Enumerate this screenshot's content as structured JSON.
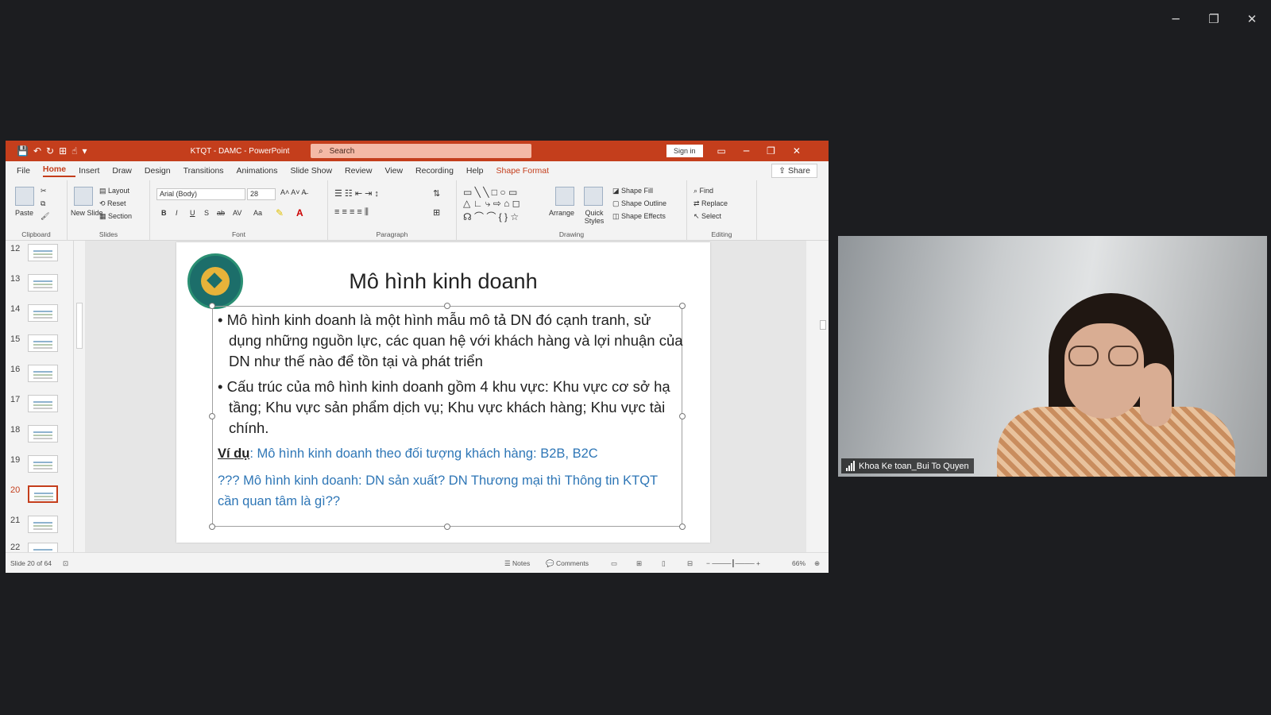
{
  "window_controls": {
    "minimize": "─",
    "restore": "❐",
    "close": "✕"
  },
  "ppt": {
    "qat_icons": [
      "save-icon",
      "undo-icon",
      "redo-icon",
      "present-icon",
      "touch-icon",
      "customize-icon"
    ],
    "qat_glyphs": [
      "💾",
      "↶",
      "↻",
      "⊞",
      "☝",
      "▾"
    ],
    "title": "KTQT - DAMC  -  PowerPoint",
    "search_placeholder": "Search",
    "sign_in": "Sign in",
    "title_controls": {
      "ribbon_display": "▭",
      "minimize": "─",
      "restore": "❐",
      "close": "✕"
    },
    "menu": [
      "File",
      "Home",
      "Insert",
      "Draw",
      "Design",
      "Transitions",
      "Animations",
      "Slide Show",
      "Review",
      "View",
      "Recording",
      "Help",
      "Shape Format"
    ],
    "active_menu": "Home",
    "share": "Share",
    "ribbon": {
      "clipboard": {
        "label": "Clipboard",
        "paste": "Paste"
      },
      "slides": {
        "label": "Slides",
        "new_slide": "New Slide",
        "layout": "Layout",
        "reset": "Reset",
        "section": "Section"
      },
      "font": {
        "label": "Font",
        "font_name": "Arial (Body)",
        "font_size": "28",
        "buttons": [
          "B",
          "I",
          "U",
          "S",
          "ab",
          "AV",
          "Aa"
        ]
      },
      "paragraph": {
        "label": "Paragraph"
      },
      "drawing": {
        "label": "Drawing",
        "arrange": "Arrange",
        "quick_styles": "Quick Styles",
        "shape_fill": "Shape Fill",
        "shape_outline": "Shape Outline",
        "shape_effects": "Shape Effects"
      },
      "editing": {
        "label": "Editing",
        "find": "Find",
        "replace": "Replace",
        "select": "Select"
      }
    },
    "thumbnails": [
      "12",
      "13",
      "14",
      "15",
      "16",
      "17",
      "18",
      "19",
      "20",
      "21",
      "22"
    ],
    "selected_slide": "20",
    "slide": {
      "title": "Mô hình kinh doanh",
      "bullet1": "• Mô hình kinh doanh là một hình mẫu mô tả DN đó cạnh tranh, sử dụng những nguồn lực, các quan hệ với khách hàng và lợi nhuận của DN như thế nào để tồn tại và phát triển",
      "bullet2": "• Cấu trúc của mô hình kinh doanh gồm 4 khu vực: Khu vực cơ sở hạ tầng; Khu vực sản phẩm dịch vụ; Khu vực khách hàng; Khu vực tài chính.",
      "example_label": "Ví dụ",
      "example_text": ": Mô hình kinh doanh theo đối tượng khách hàng: B2B, B2C",
      "question": "??? Mô hình kinh doanh: DN sản xuất? DN Thương mại thì Thông tin KTQT cần quan tâm là gì??"
    },
    "status": {
      "slide_of": "Slide 20 of 64",
      "notes": "Notes",
      "comments": "Comments",
      "zoom": "66%"
    }
  },
  "video": {
    "participant_name": "Khoa Ke toan_Bui To Quyen"
  }
}
